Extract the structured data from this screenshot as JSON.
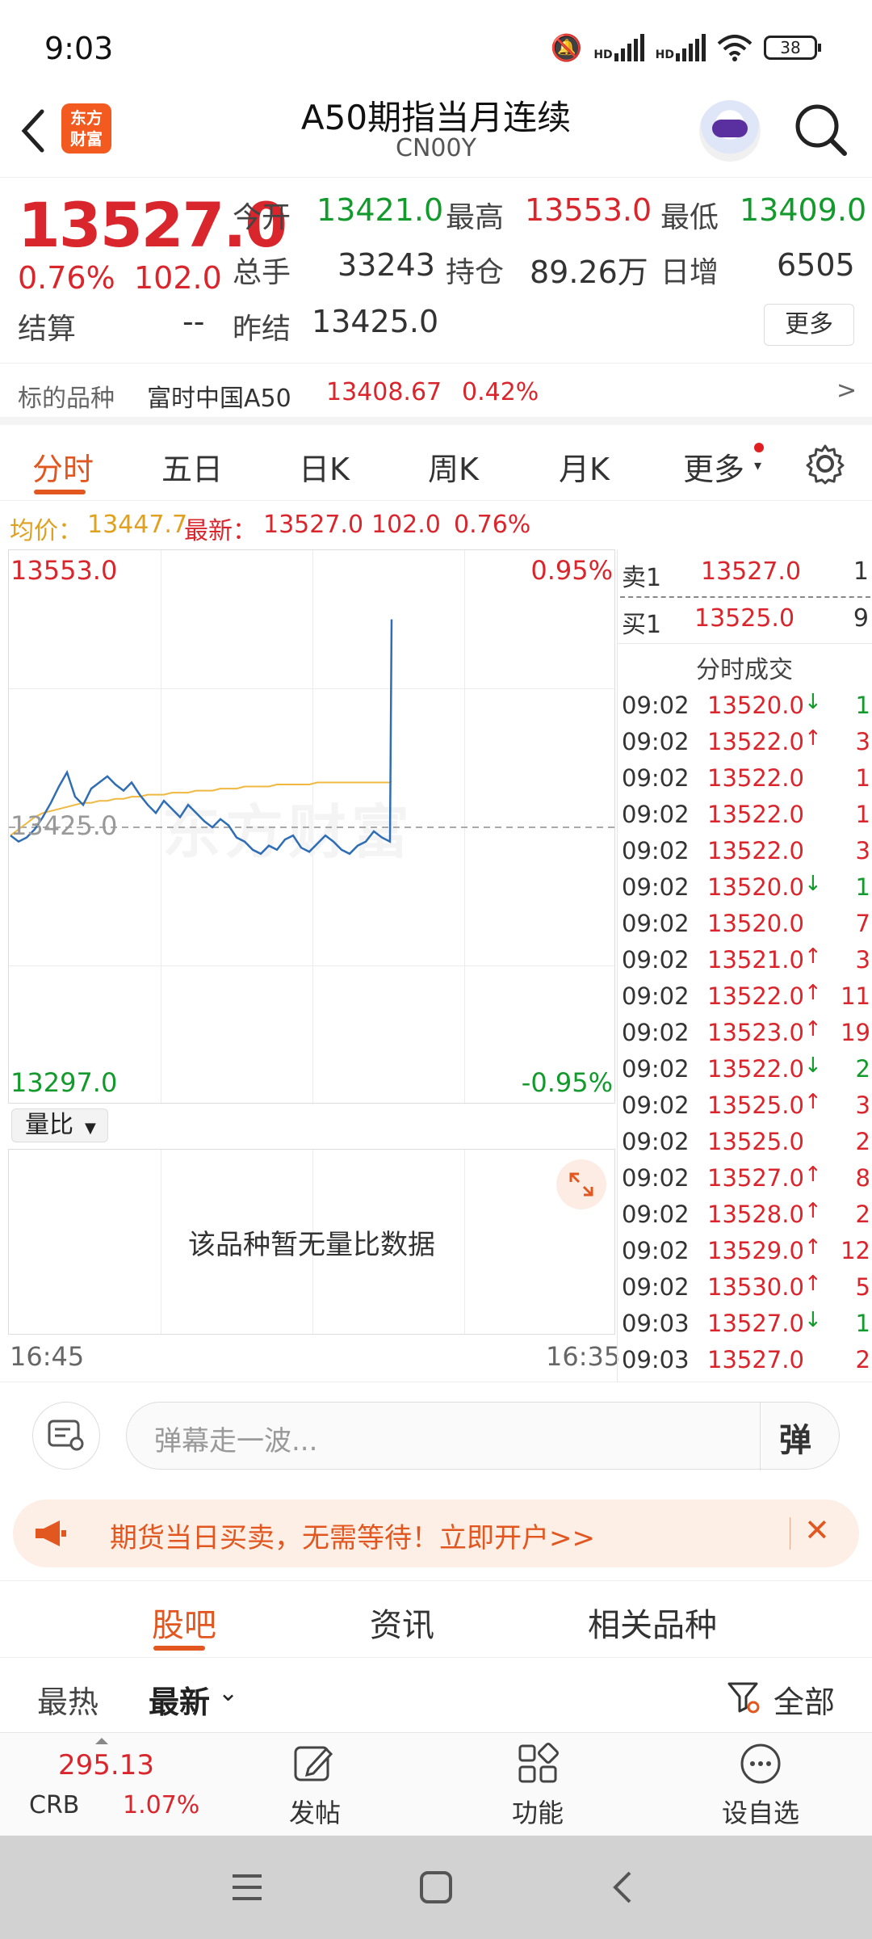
{
  "status": {
    "time": "9:03",
    "hd1": "HD",
    "hd2": "HD",
    "battery": "38"
  },
  "header": {
    "logo_line1": "东方",
    "logo_line2": "财富",
    "title": "A50期指当月连续",
    "code": "CN00Y"
  },
  "quote": {
    "price": "13527.0",
    "pct": "0.76%",
    "chg": "102.0",
    "open_label": "今开",
    "open": "13421.0",
    "high_label": "最高",
    "high": "13553.0",
    "low_label": "最低",
    "low": "13409.0",
    "vol_label": "总手",
    "vol": "33243",
    "oi_label": "持仓",
    "oi": "89.26万",
    "inc_label": "日增",
    "inc": "6505",
    "settle_label": "结算",
    "settle": "--",
    "prev_label": "昨结",
    "prev": "13425.0",
    "more": "更多"
  },
  "underlying": {
    "label": "标的品种",
    "name": "富时中国A50",
    "price": "13408.67",
    "pct": "0.42%",
    "arrow": ">"
  },
  "tabs": [
    "分时",
    "五日",
    "日K",
    "周K",
    "月K",
    "更多"
  ],
  "avgline": {
    "avg_label": "均价：",
    "avg": "13447.7",
    "last_label": "最新：",
    "last": "13527.0",
    "chg": "102.0",
    "pct": "0.76%"
  },
  "chart": {
    "top_price": "13553.0",
    "top_pct": "0.95%",
    "mid_price": "13425.0",
    "bottom_price": "13297.0",
    "bottom_pct": "-0.95%",
    "watermark": "东方财富",
    "start_time": "16:45",
    "end_time": "16:35",
    "vol_selector": "量比",
    "vol_empty": "该品种暂无量比数据"
  },
  "chart_data": {
    "type": "line",
    "ylim": [
      13297.0,
      13553.0
    ],
    "ref": 13425.0,
    "series": [
      {
        "values": [
          13421,
          13418,
          13420,
          13424,
          13430,
          13437,
          13445,
          13452,
          13440,
          13436,
          13444,
          13447,
          13450,
          13446,
          13443,
          13447,
          13441,
          13436,
          13432,
          13438,
          13434,
          13430,
          13436,
          13432,
          13428,
          13425,
          13429,
          13426,
          13420,
          13418,
          13414,
          13412,
          13416,
          13414,
          13419,
          13421,
          13415,
          13413,
          13417,
          13421,
          13418,
          13414,
          13412,
          13416,
          13418,
          13423,
          13420,
          13418,
          13527
        ]
      },
      {
        "values": [
          13421,
          13424,
          13427,
          13430,
          13432,
          13433,
          13434,
          13435,
          13436,
          13437,
          13437,
          13438,
          13438,
          13439,
          13439,
          13440,
          13440,
          13441,
          13441,
          13441,
          13442,
          13442,
          13442,
          13443,
          13443,
          13443,
          13444,
          13444,
          13444,
          13445,
          13445,
          13445,
          13445,
          13446,
          13446,
          13446,
          13446,
          13446,
          13447,
          13447,
          13447,
          13447,
          13447,
          13447,
          13447,
          13447,
          13447,
          13447,
          13447.7
        ]
      }
    ]
  },
  "book": {
    "ask_label": "卖1",
    "ask_price": "13527.0",
    "ask_qty": "1",
    "bid_label": "买1",
    "bid_price": "13525.0",
    "bid_qty": "9",
    "trades_title": "分时成交",
    "trades": [
      {
        "t": "09:02",
        "p": "13520.0",
        "d": "↓",
        "q": "1"
      },
      {
        "t": "09:02",
        "p": "13522.0",
        "d": "↑",
        "q": "3"
      },
      {
        "t": "09:02",
        "p": "13522.0",
        "d": "",
        "q": "1"
      },
      {
        "t": "09:02",
        "p": "13522.0",
        "d": "",
        "q": "1"
      },
      {
        "t": "09:02",
        "p": "13522.0",
        "d": "",
        "q": "3"
      },
      {
        "t": "09:02",
        "p": "13520.0",
        "d": "↓",
        "q": "1"
      },
      {
        "t": "09:02",
        "p": "13520.0",
        "d": "",
        "q": "7"
      },
      {
        "t": "09:02",
        "p": "13521.0",
        "d": "↑",
        "q": "3"
      },
      {
        "t": "09:02",
        "p": "13522.0",
        "d": "↑",
        "q": "11"
      },
      {
        "t": "09:02",
        "p": "13523.0",
        "d": "↑",
        "q": "19"
      },
      {
        "t": "09:02",
        "p": "13522.0",
        "d": "↓",
        "q": "2"
      },
      {
        "t": "09:02",
        "p": "13525.0",
        "d": "↑",
        "q": "3"
      },
      {
        "t": "09:02",
        "p": "13525.0",
        "d": "",
        "q": "2"
      },
      {
        "t": "09:02",
        "p": "13527.0",
        "d": "↑",
        "q": "8"
      },
      {
        "t": "09:02",
        "p": "13528.0",
        "d": "↑",
        "q": "2"
      },
      {
        "t": "09:02",
        "p": "13529.0",
        "d": "↑",
        "q": "12"
      },
      {
        "t": "09:02",
        "p": "13530.0",
        "d": "↑",
        "q": "5"
      },
      {
        "t": "09:03",
        "p": "13527.0",
        "d": "↓",
        "q": "1"
      },
      {
        "t": "09:03",
        "p": "13527.0",
        "d": "",
        "q": "2"
      }
    ]
  },
  "danmu": {
    "placeholder": "弹幕走一波...",
    "button": "弹"
  },
  "ad": {
    "text": "期货当日买卖，无需等待！立即开户>>",
    "close": "✕"
  },
  "subtabs": [
    "股吧",
    "资讯",
    "相关品种"
  ],
  "filter": {
    "hot": "最热",
    "latest": "最新",
    "all": "全部"
  },
  "bottom": {
    "crb_price": "295.13",
    "crb_label": "CRB",
    "crb_pct": "1.07%",
    "post": "发帖",
    "func": "功能",
    "watch": "设自选"
  },
  "colors": {
    "up": "#d9262c",
    "down": "#139a2c",
    "accent": "#e2561f",
    "line": "#2f6db5",
    "avg": "#f0b840"
  }
}
